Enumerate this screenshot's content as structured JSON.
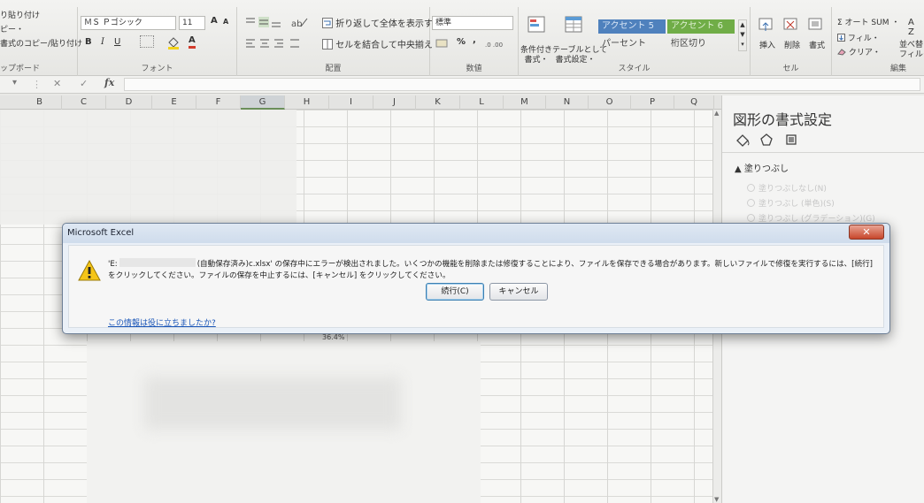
{
  "ribbon": {
    "clipboard": {
      "items": [
        "り貼り付け",
        "ピー・",
        "書式のコピー/貼り付け"
      ],
      "group_label": "ップボード"
    },
    "font": {
      "font_name": "ＭＳ Ｐゴシック",
      "font_size": "11",
      "grow_label": "A",
      "shrink_label": "A",
      "bold": "B",
      "italic": "I",
      "underline": "U",
      "font_color_label": "A",
      "group_label": "フォント"
    },
    "alignment": {
      "wrap_text": "折り返して全体を表示する",
      "merge_center": "セルを結合して中央揃え",
      "group_label": "配置"
    },
    "number": {
      "format": "標準",
      "percent": "%",
      "comma": ",",
      "group_label": "数値"
    },
    "styles": {
      "conditional": "条件付き\n書式・",
      "as_table": "テーブルとして\n書式設定・",
      "accent5": "アクセント 5",
      "accent6": "アクセント 6",
      "percent": "パーセント",
      "comma_style": "桁区切り",
      "group_label": "スタイル"
    },
    "cells": {
      "insert": "挿入",
      "delete": "削除",
      "format": "書式",
      "group_label": "セル"
    },
    "editing": {
      "autosum": "Σ オート SUM ・",
      "fill": "フィル・",
      "clear": "クリア・",
      "sort": "並べ替",
      "filter": "フィルタ",
      "group_label": "編集"
    }
  },
  "formula_bar": {
    "fx": "fx",
    "cancel": "✕",
    "enter": "✓"
  },
  "columns": [
    "B",
    "C",
    "D",
    "E",
    "F",
    "G",
    "H",
    "I",
    "J",
    "K",
    "L",
    "M",
    "N",
    "O",
    "P",
    "Q"
  ],
  "sheet": {
    "progress_text": "36.4%"
  },
  "task_pane": {
    "title": "図形の書式設定",
    "section": "塗りつぶし",
    "options": [
      "塗りつぶしなし(N)",
      "塗りつぶし (単色)(S)",
      "塗りつぶし (グラデーション)(G)"
    ]
  },
  "dialog": {
    "title": "Microsoft Excel",
    "close": "✕",
    "message_prefix": "'E:",
    "message_body": "(自動保存済み)c.xlsx' の保存中にエラーが検出されました。いくつかの機能を削除または修復することにより、ファイルを保存できる場合があります。新しいファイルで修復を実行するには、[続行] をクリックしてください。ファイルの保存を中止するには、[キャンセル] をクリックしてください。",
    "continue_button": "続行(C)",
    "cancel_button": "キャンセル",
    "help_link": "この情報は役に立ちましたか?"
  },
  "colors": {
    "accent5": "#4f81bd",
    "accent6": "#70ad47",
    "dialog_bg": "#eaf0f7",
    "close_red": "#c7462b",
    "link": "#1a56b8"
  }
}
